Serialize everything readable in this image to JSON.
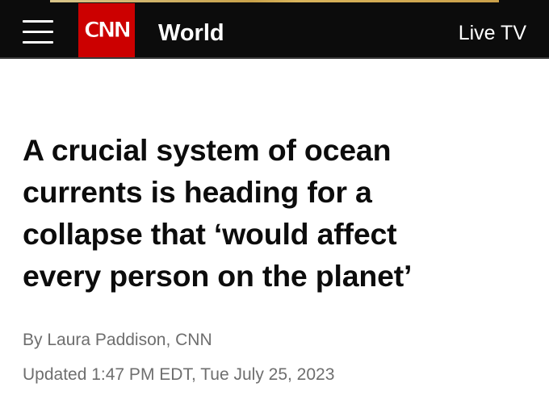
{
  "header": {
    "logo_text": "CNN",
    "section": "World",
    "live_tv": "Live TV"
  },
  "article": {
    "headline_lines": [
      "A crucial system of ocean",
      "currents is heading for a",
      "collapse that ‘would affect",
      "every person on the planet’"
    ],
    "byline_prefix": "By ",
    "author": "Laura Paddison",
    "byline_suffix": ", CNN",
    "updated": "Updated 1:47 PM EDT, Tue July 25, 2023"
  },
  "colors": {
    "header_bg": "#0c0c0c",
    "brand_red": "#cc0000",
    "headline": "#0c0c0c",
    "meta_text": "#6e6e6e"
  },
  "icons": {
    "menu": "hamburger-menu-icon"
  }
}
